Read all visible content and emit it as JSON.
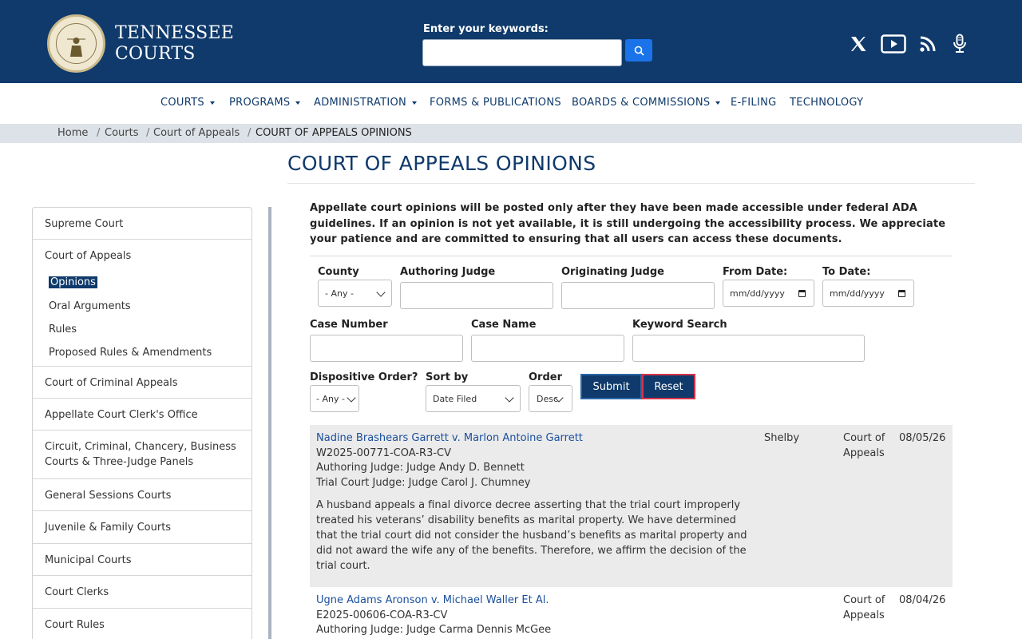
{
  "header": {
    "brand_line1": "TENNESSEE",
    "brand_line2": "COURTS",
    "search_label": "Enter your keywords:",
    "search_value": "",
    "social_icons": [
      "x-icon",
      "youtube-icon",
      "rss-icon",
      "podcast-mic-icon"
    ]
  },
  "nav": {
    "items": [
      {
        "label": "COURTS",
        "dropdown": true
      },
      {
        "label": "PROGRAMS",
        "dropdown": true
      },
      {
        "label": "ADMINISTRATION",
        "dropdown": true
      },
      {
        "label": "FORMS & PUBLICATIONS",
        "dropdown": false
      },
      {
        "label": "BOARDS & COMMISSIONS",
        "dropdown": true
      },
      {
        "label": "E-FILING",
        "dropdown": false
      },
      {
        "label": "TECHNOLOGY",
        "dropdown": false
      }
    ]
  },
  "breadcrumb": {
    "items": [
      "Home",
      "Courts",
      "Court of Appeals",
      "COURT OF APPEALS OPINIONS"
    ],
    "separator": "/"
  },
  "page": {
    "title": "COURT OF APPEALS OPINIONS",
    "notice": "Appellate court opinions will be posted only after they have been made accessible under federal ADA guidelines. If an opinion is not yet available, it is still undergoing the accessibility process. We appreciate your patience and are committed to ensuring that all users can access these documents."
  },
  "sidebar": {
    "items": [
      "Supreme Court",
      "Court of Appeals",
      "Court of Criminal Appeals",
      "Appellate Court Clerk's Office",
      "Circuit, Criminal, Chancery, Business Courts & Three-Judge Panels",
      "General Sessions Courts",
      "Juvenile & Family Courts",
      "Municipal Courts",
      "Court Clerks",
      "Court Rules"
    ],
    "sub_items": [
      "Opinions",
      "Oral Arguments",
      "Rules",
      "Proposed Rules & Amendments"
    ],
    "active_sub": "Opinions"
  },
  "form": {
    "county_label": "County",
    "county_value": "- Any -",
    "authoring_judge_label": "Authoring Judge",
    "originating_judge_label": "Originating Judge",
    "from_date_label": "From Date:",
    "from_date_placeholder": "mm/dd/yyyy",
    "to_date_label": "To Date:",
    "to_date_placeholder": "mm/dd/yyyy",
    "case_number_label": "Case Number",
    "case_name_label": "Case Name",
    "keyword_label": "Keyword Search",
    "dispositive_label": "Dispositive Order?",
    "dispositive_value": "- Any -",
    "sort_label": "Sort by",
    "sort_value": "Date Filed",
    "order_label": "Order",
    "order_value": "Desc",
    "submit_label": "Submit",
    "reset_label": "Reset"
  },
  "results": [
    {
      "title": "Nadine Brashears Garrett v. Marlon Antoine Garrett",
      "case_number": "W2025-00771-COA-R3-CV",
      "authoring_judge": "Authoring Judge: Judge Andy D. Bennett",
      "trial_judge": "Trial Court Judge: Judge Carol J. Chumney",
      "summary": "A husband appeals a final divorce decree asserting that the trial court improperly treated his veterans’ disability benefits as marital property. We have determined that the trial court did not consider the husband’s benefits as marital property and did not award the wife any of the benefits. Therefore, we affirm the decision of the trial court.",
      "county": "Shelby",
      "court": "Court of Appeals",
      "date": "08/05/26"
    },
    {
      "title": "Ugne Adams Aronson v. Michael Waller Et Al.",
      "case_number": "E2025-00606-COA-R3-CV",
      "authoring_judge": "Authoring Judge: Judge Carma Dennis McGee",
      "trial_judge": "",
      "summary": "",
      "county": "",
      "court": "Court of Appeals",
      "date": "08/04/26"
    }
  ],
  "colors": {
    "header_bg": "#0f3a6b",
    "link": "#1a4f9c",
    "search_button": "#1a73e8",
    "reset_border": "#d6334a"
  }
}
